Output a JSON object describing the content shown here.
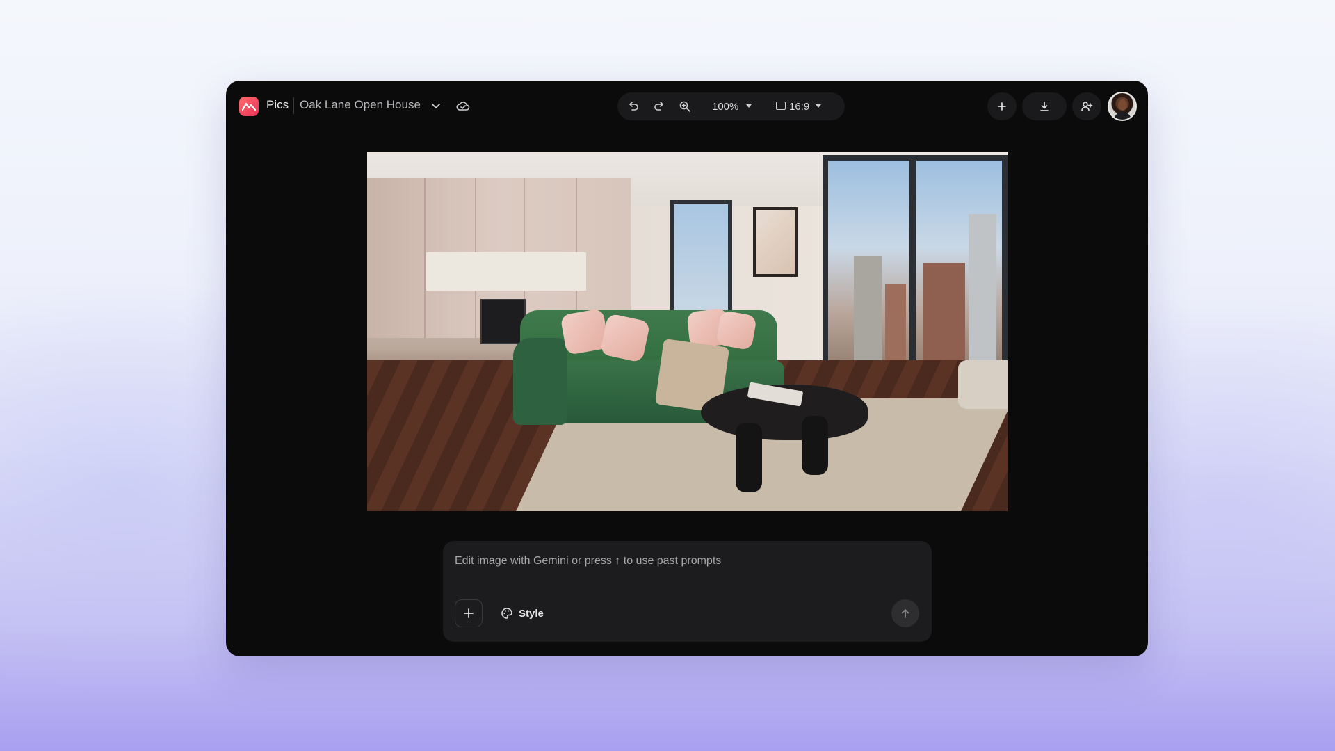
{
  "header": {
    "app_name": "Pics",
    "project_name": "Oak Lane Open House"
  },
  "toolbar": {
    "zoom_level": "100%",
    "aspect_ratio": "16:9"
  },
  "prompt": {
    "placeholder": "Edit image with Gemini or press ↑ to use past prompts",
    "value": "",
    "style_label": "Style"
  },
  "icons": {
    "logo": "pics-logo-icon",
    "project_menu": "chevron-down-icon",
    "cloud": "cloud-icon",
    "undo": "undo-icon",
    "redo": "redo-icon",
    "zoom": "zoom-in-icon",
    "aspect": "aspect-ratio-icon",
    "add": "plus-icon",
    "download": "download-icon",
    "share": "add-person-icon",
    "style": "palette-icon",
    "send": "arrow-up-icon"
  },
  "colors": {
    "logo_accent": "#e8335a",
    "window_bg": "#0b0b0c",
    "panel_bg": "#1a1a1c"
  }
}
